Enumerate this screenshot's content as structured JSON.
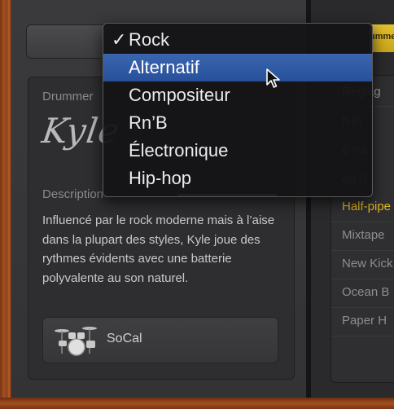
{
  "menu": {
    "items": [
      {
        "label": "Rock",
        "checked": true
      },
      {
        "label": "Alternatif",
        "selected": true
      },
      {
        "label": "Compositeur"
      },
      {
        "label": "Rn’B"
      },
      {
        "label": "Électronique"
      },
      {
        "label": "Hip-hop"
      }
    ],
    "check_glyph": "✓"
  },
  "drummer": {
    "label": "Drummer",
    "name_signature": "Kyle"
  },
  "description": {
    "label": "Description",
    "text": "Influencé par le rock moderne mais à l’aise dans la plupart des styles, Kyle joue des rythmes évidents avec une batterie polyvalente au son naturel."
  },
  "kit": {
    "label": "SoCal",
    "icon": "drum-kit-icon"
  },
  "right_tab": {
    "label": "ummer"
  },
  "presets": [
    {
      "label": "Réglag"
    },
    {
      "label": "h th"
    },
    {
      "label": "o Pa"
    },
    {
      "label": "en S"
    },
    {
      "label": "Half-pipe",
      "active": true
    },
    {
      "label": "Mixtape"
    },
    {
      "label": "New Kick"
    },
    {
      "label": "Ocean B"
    },
    {
      "label": "Paper H"
    }
  ],
  "colors": {
    "selection": "#2f5aa5",
    "active_preset": "#e3b71f"
  }
}
